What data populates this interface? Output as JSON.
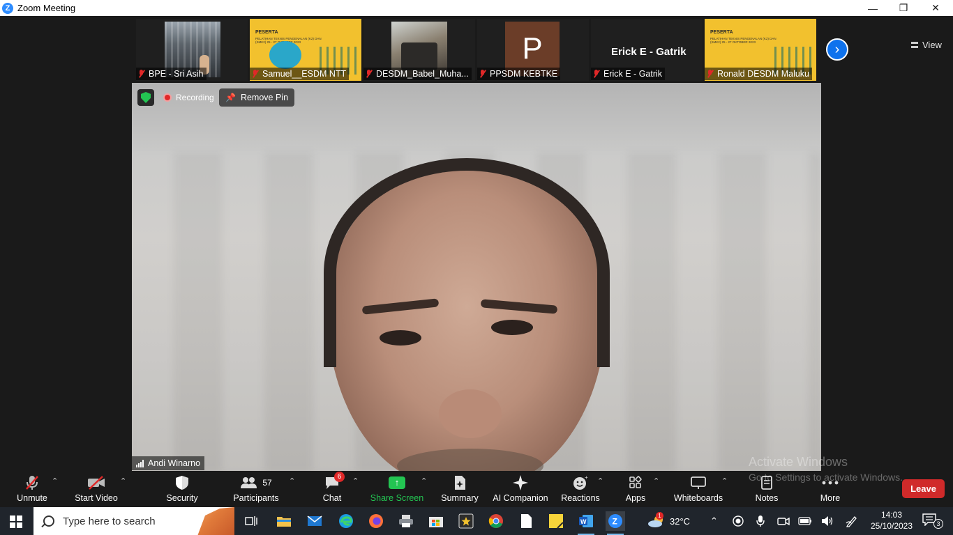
{
  "window": {
    "title": "Zoom Meeting",
    "logo_letter": "Z",
    "minimize": "—",
    "restore": "❐",
    "close": "✕"
  },
  "participants_strip": {
    "thumbnails": [
      {
        "name": "BPE - Sri Asih",
        "muted": true
      },
      {
        "name": "Samuel__ESDM NTT",
        "muted": true
      },
      {
        "name": "DESDM_Babel_Muha...",
        "muted": true
      },
      {
        "name": "PPSDM KEBTKE",
        "muted": true,
        "avatar_letter": "P"
      },
      {
        "name": "Erick E - Gatrik",
        "muted": true,
        "display_name": "Erick E - Gatrik"
      },
      {
        "name": "Ronald DESDM Maluku",
        "muted": true
      }
    ],
    "poster_heading": "PESERTA",
    "poster_text": "PELATIHAN TEKNIS PENGENALAN (K2) DAN (SMK2) 25 - 27 OKTOBER 2023",
    "next_icon": "›",
    "view_label": "View"
  },
  "main_video": {
    "recording_label": "Recording",
    "remove_pin_label": "Remove Pin",
    "speaker_name": "Andi Winarno"
  },
  "toolbar": {
    "unmute": "Unmute",
    "start_video": "Start Video",
    "security": "Security",
    "participants": "Participants",
    "participants_count": "57",
    "chat": "Chat",
    "chat_badge": "6",
    "share_screen": "Share Screen",
    "summary": "Summary",
    "ai_companion": "AI Companion",
    "reactions": "Reactions",
    "apps": "Apps",
    "whiteboards": "Whiteboards",
    "notes": "Notes",
    "more": "More",
    "leave": "Leave"
  },
  "activation": {
    "title": "Activate Windows",
    "subtitle": "Go to Settings to activate Windows."
  },
  "taskbar": {
    "search_placeholder": "Type here to search",
    "weather_temp": "32°C",
    "weather_badge": "1",
    "time": "14:03",
    "date": "25/10/2023",
    "notification_count": "3"
  }
}
